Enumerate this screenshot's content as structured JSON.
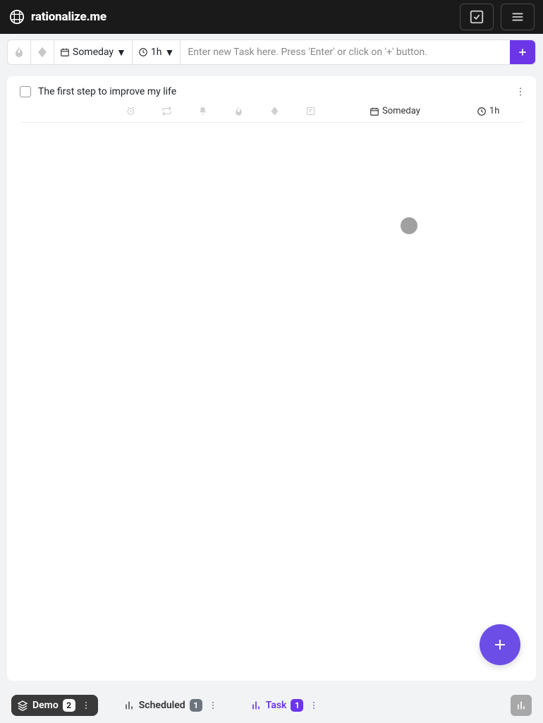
{
  "header": {
    "brand": "rationalize.me"
  },
  "toolbar": {
    "schedule_label": "Someday",
    "duration_label": "1h",
    "input_placeholder": "Enter new Task here. Press 'Enter' or click on '+' button."
  },
  "tasks": [
    {
      "title": "The first step to improve my life",
      "schedule": "Someday",
      "duration": "1h"
    }
  ],
  "bottom": {
    "demo_label": "Demo",
    "demo_count": "2",
    "scheduled_label": "Scheduled",
    "scheduled_count": "1",
    "task_label": "Task",
    "task_count": "1"
  }
}
